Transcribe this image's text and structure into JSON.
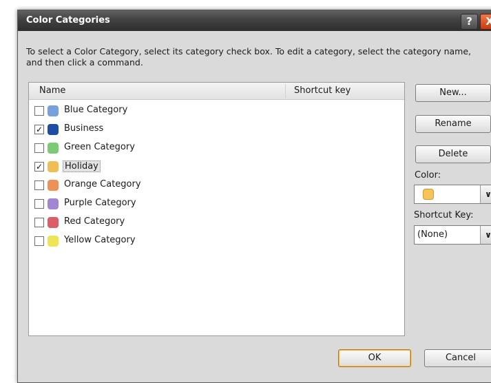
{
  "window": {
    "title": "Color Categories",
    "help_glyph": "?",
    "close_glyph": "X"
  },
  "instructions": "To select a Color Category, select its category check box.  To edit a category, select the category name, and then click a command.",
  "list": {
    "columns": {
      "name": "Name",
      "shortcut": "Shortcut key"
    },
    "items": [
      {
        "label": "Blue Category",
        "checked": false,
        "color": "#7aa6e3"
      },
      {
        "label": "Business",
        "checked": true,
        "color": "#1f4fa8"
      },
      {
        "label": "Green Category",
        "checked": false,
        "color": "#7fd07a"
      },
      {
        "label": "Holiday",
        "checked": true,
        "color": "#f6c45a",
        "selected": true
      },
      {
        "label": "Orange Category",
        "checked": false,
        "color": "#f3955a"
      },
      {
        "label": "Purple Category",
        "checked": false,
        "color": "#a68ad8"
      },
      {
        "label": "Red Category",
        "checked": false,
        "color": "#e2606a"
      },
      {
        "label": "Yellow Category",
        "checked": false,
        "color": "#f4ec5a"
      }
    ]
  },
  "buttons": {
    "new": "New...",
    "rename": "Rename",
    "delete": "Delete",
    "ok": "OK",
    "cancel": "Cancel"
  },
  "color": {
    "label": "Color:",
    "value_color": "#f6c45a"
  },
  "shortcut": {
    "label": "Shortcut Key:",
    "value": "(None)"
  },
  "dropdown_glyph": "∨"
}
